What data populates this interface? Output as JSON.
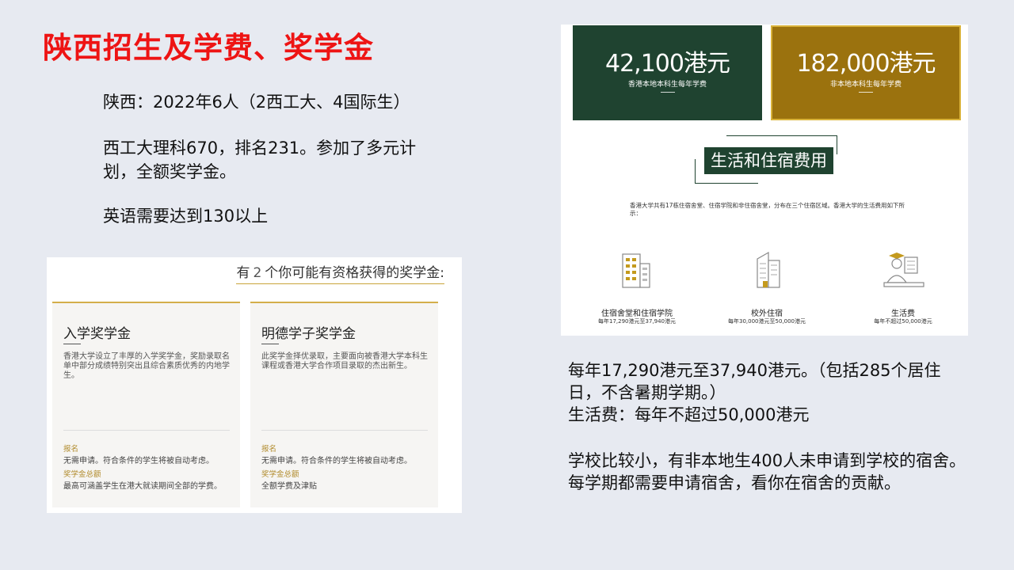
{
  "title": "陕西招生及学费、奖学金",
  "left_text": {
    "p1": "陕西：2022年6人（2西工大、4国际生）",
    "p2": "西工大理科670，排名231。参加了多元计划，全额奖学金。",
    "p3": "英语需要达到130以上"
  },
  "scholarship_panel": {
    "heading_prefix": "有",
    "heading_count": "2",
    "heading_suffix": "个你可能有资格获得的奖学金:",
    "cards": [
      {
        "title": "入学奖学金",
        "description": "香港大学设立了丰厚的入学奖学金，奖励录取名单中部分成绩特别突出且综合素质优秀的内地学生。",
        "apply_label": "报名",
        "apply_value": "无需申请。符合条件的学生将被自动考虑。",
        "amount_label": "奖学金总额",
        "amount_value": "最高可涵盖学生在港大就读期间全部的学费。"
      },
      {
        "title": "明德学子奖学金",
        "description": "此奖学金择优录取，主要面向被香港大学本科生课程或香港大学合作项目录取的杰出新生。",
        "apply_label": "报名",
        "apply_value": "无需申请。符合条件的学生将被自动考虑。",
        "amount_label": "奖学金总额",
        "amount_value": "全额学费及津贴"
      }
    ]
  },
  "infographic": {
    "local_fee": {
      "amount": "42,100港元",
      "caption": "香港本地本科生每年学费"
    },
    "nonlocal_fee": {
      "amount": "182,000港元",
      "caption": "非本地本科生每年学费"
    },
    "living_title": "生活和住宿费用",
    "intro": "香港大学共有17栋住宿舍堂、住宿学院和非住宿舍堂，分布在三个住宿区域。香港大学的生活费用如下所示：",
    "items": [
      {
        "label": "住宿舍堂和住宿学院",
        "cost": "每年17,290港元至37,940港元",
        "icon": "dormitory-building-icon"
      },
      {
        "label": "校外住宿",
        "cost": "每年30,000港元至50,000港元",
        "icon": "apartment-building-icon"
      },
      {
        "label": "生活费",
        "cost": "每年不超过50,000港元",
        "icon": "student-reading-icon"
      }
    ],
    "colors": {
      "green": "#1f4330",
      "gold": "#9b720e",
      "gold_border": "#d9b23a"
    }
  },
  "right_text": {
    "p1_line1": "每年17,290港元至37,940港元。（包括285个居住日，不含暑期学期。）",
    "p1_line2": "生活费：每年不超过50,000港元",
    "p2": "学校比较小，有非本地生400人未申请到学校的宿舍。每学期都需要申请宿舍，看你在宿舍的贡献。"
  }
}
